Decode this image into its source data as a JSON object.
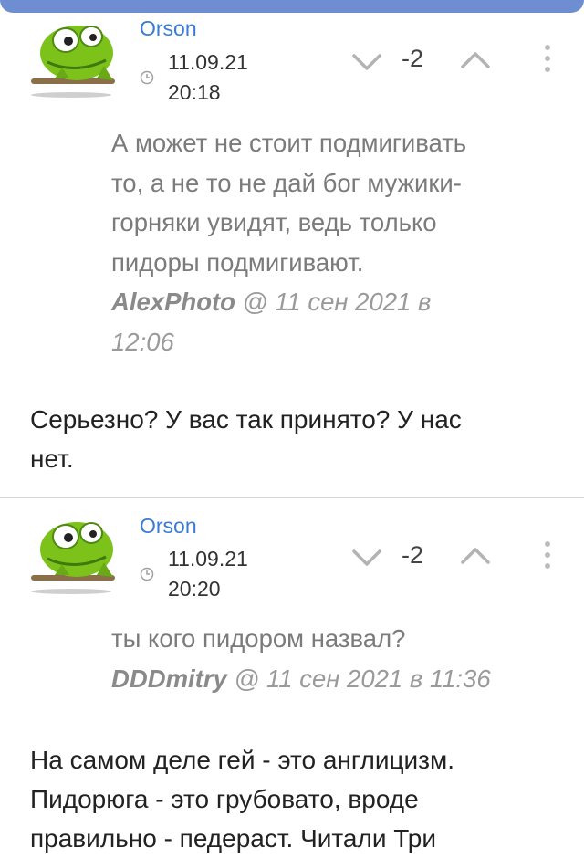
{
  "comments": [
    {
      "author": "Orson",
      "date": "11.09.21",
      "time": "20:18",
      "score": "-2",
      "quote_lines": [
        "А может не стоит подмигивать",
        "то, а не то не дай бог мужики-",
        "горняки увидят, ведь только",
        "пидоры подмигивают."
      ],
      "quote_author": "AlexPhoto",
      "quote_meta_1": " @ 11 сен 2021 в",
      "quote_meta_2": "12:06",
      "reply_lines": [
        "Серьезно? У вас так принято? У нас",
        "нет."
      ]
    },
    {
      "author": "Orson",
      "date": "11.09.21",
      "time": "20:20",
      "score": "-2",
      "quote_lines": [
        "ты кого пидором назвал?"
      ],
      "quote_author": "DDDmitry",
      "quote_meta_1": " @ 11 сен 2021 в 11:36",
      "reply_lines": [
        "На самом деле гей - это англицизм.",
        "Пидорюга - это грубовато, вроде",
        "правильно - педераст. Читали Три"
      ]
    }
  ],
  "icons": {
    "avatar": "green-cartoon-frog-icon",
    "clock": "clock-icon",
    "down": "chevron-down-icon",
    "up": "chevron-up-icon",
    "more": "more-vertical-icon"
  },
  "colors": {
    "accent": "#3a7bd5",
    "topbar": "#6f8ed2",
    "avatar_green": "#7cc21b"
  }
}
